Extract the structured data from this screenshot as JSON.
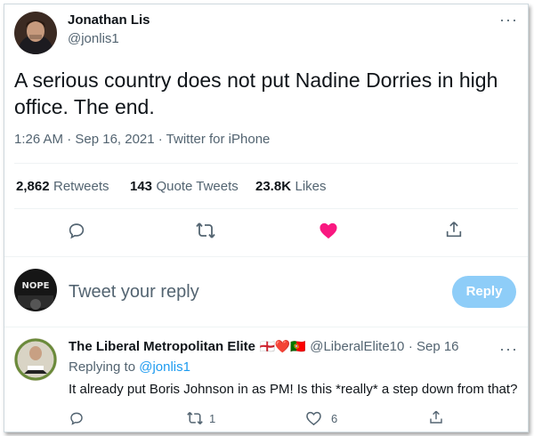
{
  "tweet": {
    "author_name": "Jonathan Lis",
    "author_handle": "@jonlis1",
    "text": "A serious country does not put Nadine Dorries in high office. The end.",
    "timestamp": "1:26 AM · Sep 16, 2021 · Twitter for iPhone",
    "more_icon": "more-horizontal-icon",
    "stats": {
      "retweets_count": "2,862",
      "retweets_label": "Retweets",
      "quotes_count": "143",
      "quotes_label": "Quote Tweets",
      "likes_count": "23.8K",
      "likes_label": "Likes"
    },
    "actions": [
      "reply-icon",
      "retweet-icon",
      "like-icon",
      "share-icon"
    ],
    "like_color": "#f91880"
  },
  "composer": {
    "avatar_text": "NOPE",
    "placeholder": "Tweet your reply",
    "button_label": "Reply",
    "button_color": "#8ecdf8"
  },
  "reply": {
    "author_name": "The Liberal Metropolitan Elite",
    "author_emojis": "🏴󠁧󠁢󠁥󠁮󠁧󠁿❤️🇵🇹",
    "author_handle": "@LiberalElite10",
    "date": "· Sep 16",
    "replying_prefix": "Replying to",
    "replying_to": "@jonlis1",
    "text": "It already put Boris Johnson in as PM! Is this *really* a step down from that?",
    "retweet_count": "1",
    "like_count": "6"
  },
  "colors": {
    "accent": "#1d9bf0",
    "secondary_text": "#536471",
    "divider": "#eff3f4"
  }
}
